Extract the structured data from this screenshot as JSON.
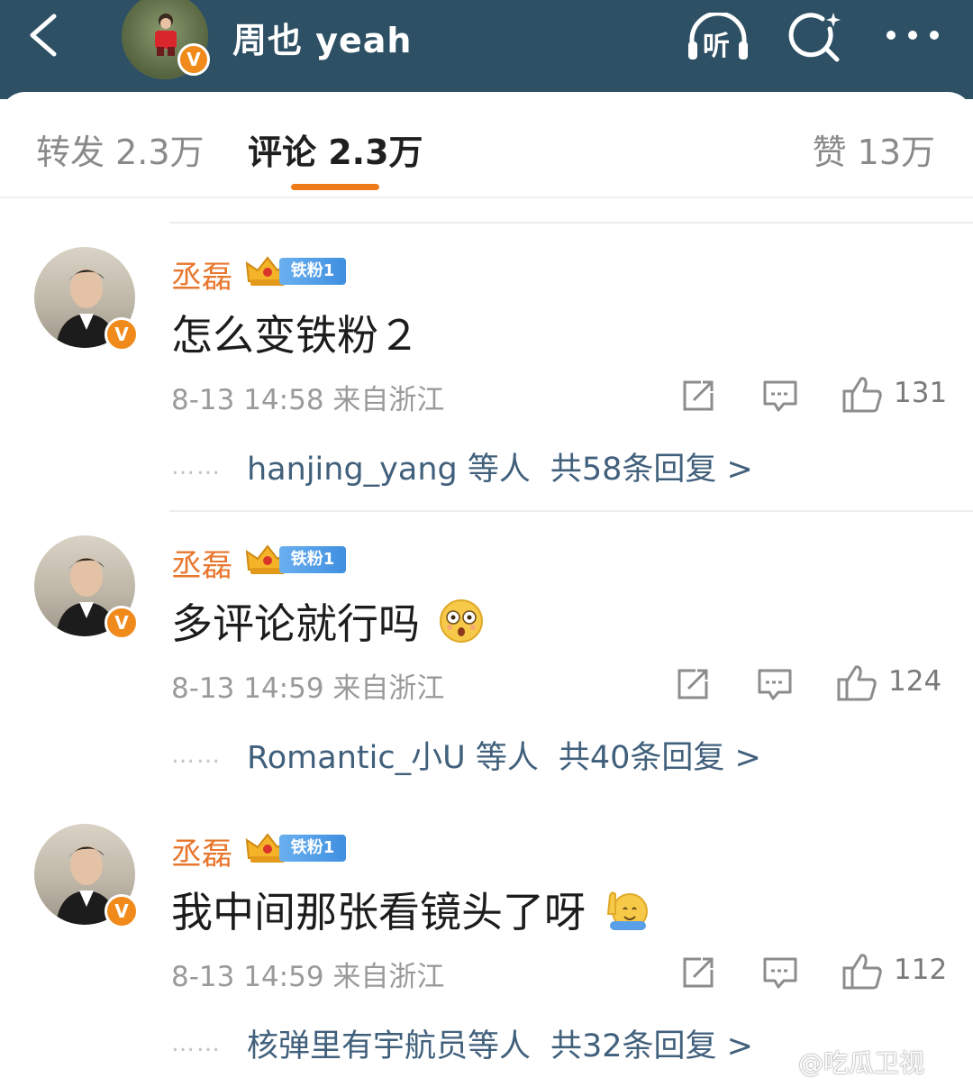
{
  "header": {
    "account_name": "周也 yeah",
    "verified_mark": "V",
    "listen_label": "听"
  },
  "tabs": [
    {
      "label": "转发 2.3万"
    },
    {
      "label": "评论 2.3万"
    },
    {
      "label": "赞 13万"
    }
  ],
  "comments": [
    {
      "author": "丞磊",
      "fan_badge": "铁粉1",
      "text": "怎么变铁粉２",
      "emoji": "",
      "time_location": "8-13 14:58  来自浙江",
      "likes": "131",
      "reply_dots": "……",
      "reply_users": "hanjing_yang 等人",
      "reply_total": "共58条回复 >"
    },
    {
      "author": "丞磊",
      "fan_badge": "铁粉1",
      "text": "多评论就行吗",
      "emoji": "astonished-face",
      "time_location": "8-13 14:59  来自浙江",
      "likes": "124",
      "reply_dots": "……",
      "reply_users": "Romantic_小U 等人",
      "reply_total": "共40条回复 >"
    },
    {
      "author": "丞磊",
      "fan_badge": "铁粉1",
      "text": "我中间那张看镜头了呀",
      "emoji": "raising-hand-face",
      "time_location": "8-13 14:59  来自浙江",
      "likes": "112",
      "reply_dots": "……",
      "reply_users": "核弹里有宇航员等人",
      "reply_total": "共32条回复 >"
    }
  ],
  "watermark": "@吃瓜卫视",
  "colors": {
    "header_bg": "#2e5064",
    "accent_orange": "#f07a1a",
    "author_name": "#e8772e",
    "reply_link": "#41607c",
    "fan_badge_blue": "#3f8fe0"
  }
}
